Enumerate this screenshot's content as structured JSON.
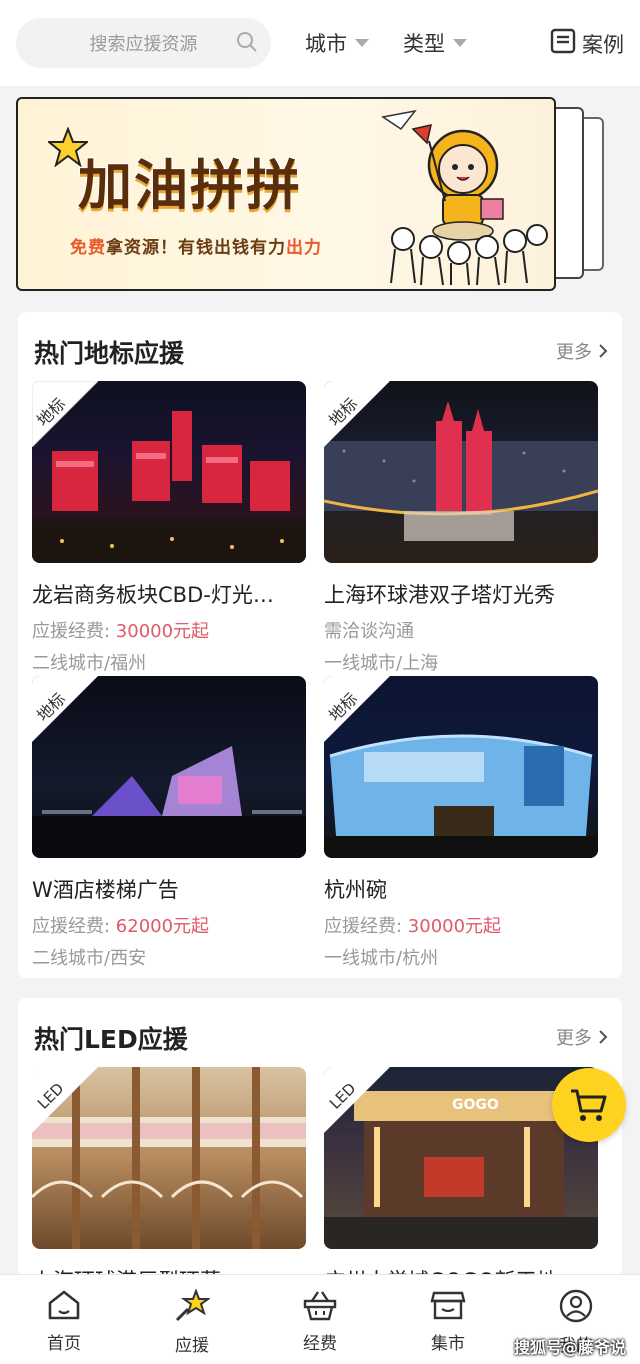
{
  "search": {
    "placeholder": "搜索应援资源"
  },
  "filters": {
    "city": "城市",
    "type": "类型"
  },
  "cases": {
    "label": "案例"
  },
  "banner": {
    "title": "加油拼拼",
    "sub_free": "免费",
    "sub_mid": "拿资源！有钱出钱有力",
    "sub_end": "出力"
  },
  "sections": [
    {
      "title": "热门地标应援",
      "more": "更多",
      "cards": [
        {
          "tag": "地标",
          "name": "龙岩商务板块CBD-灯光…",
          "fee_label": "应援经费: ",
          "fee": "30000元起",
          "city": "二线城市/福州"
        },
        {
          "tag": "地标",
          "name": "上海环球港双子塔灯光秀",
          "fee_label": "",
          "fee": "",
          "fee_plain": "需洽谈沟通",
          "city": "一线城市/上海"
        },
        {
          "tag": "地标",
          "name": "W酒店楼梯广告",
          "fee_label": "应援经费: ",
          "fee": "62000元起",
          "city": "二线城市/西安"
        },
        {
          "tag": "地标",
          "name": "杭州碗",
          "fee_label": "应援经费: ",
          "fee": "30000元起",
          "city": "一线城市/杭州"
        }
      ]
    },
    {
      "title": "热门LED应援",
      "more": "更多",
      "cards": [
        {
          "tag": "LED",
          "name": "上海环球港巨型环幕"
        },
        {
          "tag": "LED",
          "name": "广州大学城GOGO新天地…"
        }
      ]
    }
  ],
  "tabs": [
    {
      "label": "首页",
      "icon": "home-icon"
    },
    {
      "label": "应援",
      "icon": "star-wand-icon"
    },
    {
      "label": "经费",
      "icon": "basket-icon"
    },
    {
      "label": "集市",
      "icon": "store-icon"
    },
    {
      "label": "我的",
      "icon": "user-icon"
    }
  ],
  "watermark": "搜狐号@藤爷说",
  "colors": {
    "accent": "#ffd21f",
    "price": "#e05a6a"
  }
}
